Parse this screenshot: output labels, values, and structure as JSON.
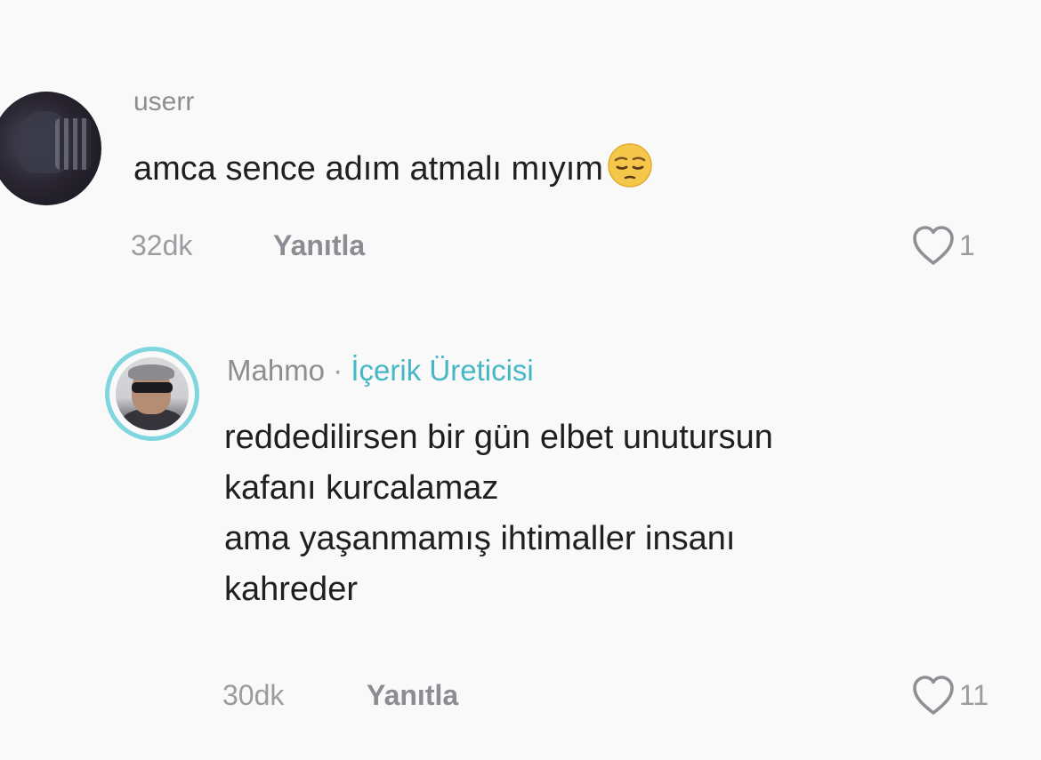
{
  "comments": [
    {
      "username": "userr",
      "text_lines": [
        "amca sence adım atmalı mıyım"
      ],
      "emoji": "pensive-face-emoji",
      "time": "32dk",
      "reply_label": "Yanıtla",
      "likes": "1"
    },
    {
      "username": "Mahmo",
      "separator": "·",
      "badge": "İçerik Üreticisi",
      "text_lines": [
        "reddedilirsen bir gün elbet unutursun",
        "kafanı kurcalamaz",
        "ama yaşanmamış ihtimaller insanı",
        "kahreder"
      ],
      "time": "30dk",
      "reply_label": "Yanıtla",
      "likes": "11"
    }
  ],
  "colors": {
    "background": "#f9f9f9",
    "text": "#1f1f22",
    "muted": "#9b9ba0",
    "creator_badge": "#46b7c6",
    "avatar_ring": "#7fd6df"
  },
  "icons": {
    "like": "heart-outline-icon"
  }
}
